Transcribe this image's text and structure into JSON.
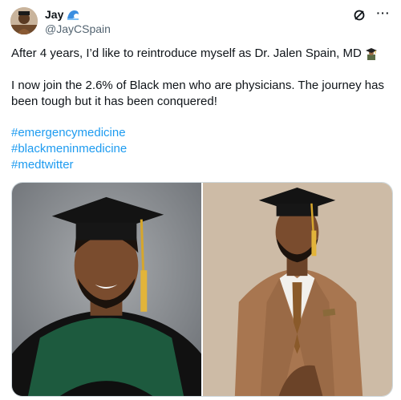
{
  "author": {
    "display_name": "Jay",
    "handle": "@JayCSpain",
    "badge_icon": "wave-emoji-icon",
    "avatar_icon": "profile-photo"
  },
  "actions": {
    "grok_icon": "grok-slash-icon",
    "more_icon": "more-dots-icon",
    "more_label": "···"
  },
  "tweet": {
    "line1": "After 4 years, I’d like to reintroduce myself as Dr. Jalen Spain, MD",
    "line1_emoji": "graduation-cap-emoji-icon",
    "line2": "I now join the 2.6% of Black men who are physicians. The journey has been tough but it has been conquered!",
    "hashtags": [
      "#emergencymedicine",
      "#blackmeninmedicine",
      "#medtwitter"
    ]
  },
  "media": {
    "photos": [
      {
        "icon": "graduation-portrait-gown-photo"
      },
      {
        "icon": "graduation-portrait-suit-photo"
      }
    ]
  },
  "colors": {
    "text": "#0f1419",
    "secondary": "#536471",
    "link": "#1d9bf0",
    "border": "#cfd9de"
  }
}
